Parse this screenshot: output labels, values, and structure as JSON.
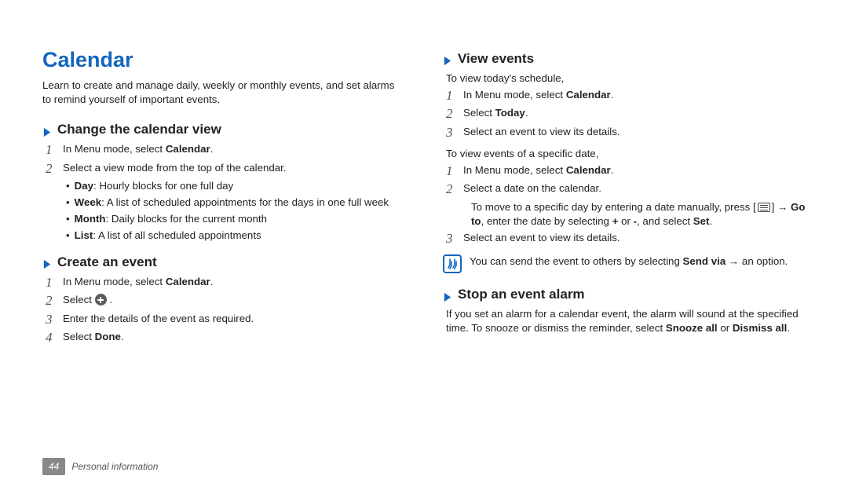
{
  "title": "Calendar",
  "intro": "Learn to create and manage daily, weekly or monthly events, and set alarms to remind yourself of important events.",
  "left": {
    "changeView": {
      "heading": "Change the calendar view",
      "steps": {
        "s1a": "In Menu mode, select ",
        "s1b": "Calendar",
        "s1c": ".",
        "s2": "Select a view mode from the top of the calendar."
      },
      "bullets": {
        "day_b": "Day",
        "day_t": ": Hourly blocks for one full day",
        "week_b": "Week",
        "week_t": ": A list of scheduled appointments for the days in one full week",
        "month_b": "Month",
        "month_t": ": Daily blocks for the current month",
        "list_b": "List",
        "list_t": ": A list of all scheduled appointments"
      }
    },
    "createEvent": {
      "heading": "Create an event",
      "s1a": "In Menu mode, select ",
      "s1b": "Calendar",
      "s1c": ".",
      "s2a": "Select ",
      "s2b": " .",
      "s3": "Enter the details of the event as required.",
      "s4a": "Select ",
      "s4b": "Done",
      "s4c": "."
    }
  },
  "right": {
    "viewEvents": {
      "heading": "View events",
      "p1": "To view today's schedule,",
      "s1a": "In Menu mode, select ",
      "s1b": "Calendar",
      "s1c": ".",
      "s2a": "Select ",
      "s2b": "Today",
      "s2c": ".",
      "s3": "Select an event to view its details.",
      "p2": "To view events of a specific date,",
      "t1a": "In Menu mode, select ",
      "t1b": "Calendar",
      "t1c": ".",
      "t2": "Select a date on the calendar.",
      "t2suba": "To move to a specific day by entering a date manually, press [",
      "t2subb": "] → ",
      "t2sub_goto": "Go to",
      "t2subc": ", enter the date by selecting ",
      "t2sub_plus": "+",
      "t2subd": " or ",
      "t2sub_minus": "-",
      "t2sube": ", and select ",
      "t2sub_set": "Set",
      "t2subf": ".",
      "t3": "Select an event to view its details.",
      "note_a": "You can send the event to others by selecting ",
      "note_b": "Send via",
      "note_c": " → an option."
    },
    "stopAlarm": {
      "heading": "Stop an event alarm",
      "p_a": "If you set an alarm for a calendar event, the alarm will sound at the specified time. To snooze or dismiss the reminder, select ",
      "p_snooze": "Snooze all",
      "p_b": " or ",
      "p_dismiss": "Dismiss all",
      "p_c": "."
    }
  },
  "footer": {
    "page": "44",
    "section": "Personal information"
  }
}
